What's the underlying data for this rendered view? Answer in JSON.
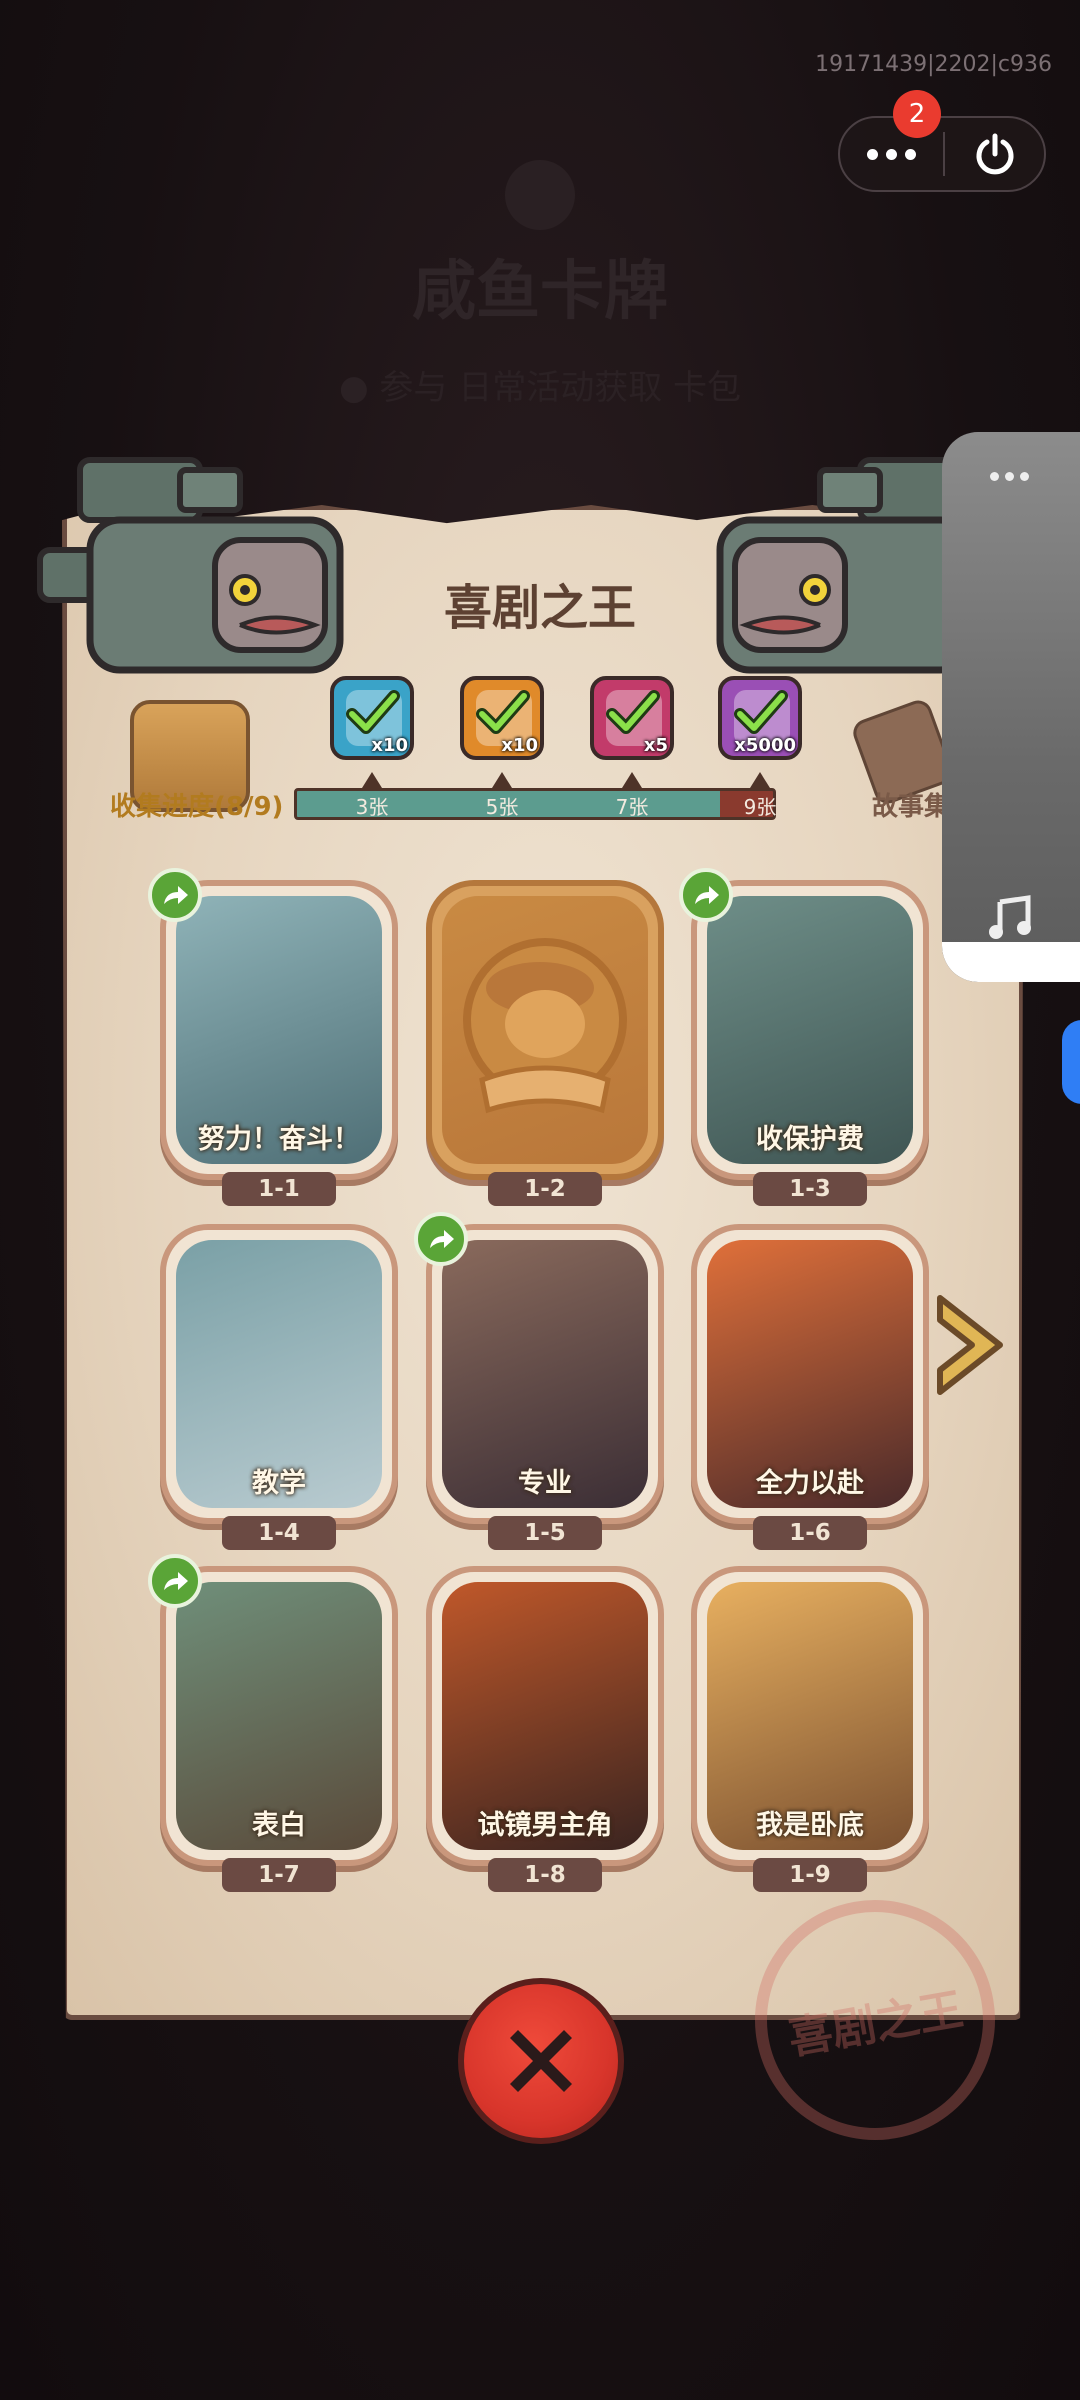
{
  "status": {
    "user_id": "19171439|2202|c936",
    "badge_count": "2"
  },
  "background": {
    "title": "咸鱼卡牌",
    "subtitle": "● 参与 日常活动获取 卡包"
  },
  "panel": {
    "title": "喜剧之王",
    "collection_label": "收集进度(8/9)",
    "story_label": "故事集",
    "stamp_text": "喜剧之王",
    "progress": {
      "collected": 8,
      "total": 9
    },
    "milestones": [
      {
        "label": "3张",
        "qty": "x10",
        "color": "#3aa3c8"
      },
      {
        "label": "5张",
        "qty": "x10",
        "color": "#e08a2a"
      },
      {
        "label": "7张",
        "qty": "x5",
        "color": "#c23b6a"
      },
      {
        "label": "9张",
        "qty": "x5000",
        "color": "#9a4fb5"
      }
    ]
  },
  "cards": [
    {
      "code": "1-1",
      "name": "努力！奋斗！",
      "shared": true,
      "locked": false,
      "art": [
        "#8fb3b8",
        "#4f6f76"
      ]
    },
    {
      "code": "1-2",
      "name": "",
      "shared": false,
      "locked": true,
      "art": [
        "#c98a43",
        "#b9773a"
      ]
    },
    {
      "code": "1-3",
      "name": "收保护费",
      "shared": true,
      "locked": false,
      "art": [
        "#6e8e88",
        "#3f5553"
      ]
    },
    {
      "code": "1-4",
      "name": "教学",
      "shared": false,
      "locked": false,
      "art": [
        "#7aa0a6",
        "#b9cbd0"
      ]
    },
    {
      "code": "1-5",
      "name": "专业",
      "shared": true,
      "locked": false,
      "art": [
        "#8a6a5c",
        "#3b2e35"
      ]
    },
    {
      "code": "1-6",
      "name": "全力以赴",
      "shared": false,
      "locked": false,
      "art": [
        "#e0703a",
        "#4a2a2a"
      ]
    },
    {
      "code": "1-7",
      "name": "表白",
      "shared": true,
      "locked": false,
      "art": [
        "#6f8f7a",
        "#5a4a3a"
      ]
    },
    {
      "code": "1-8",
      "name": "试镜男主角",
      "shared": false,
      "locked": false,
      "art": [
        "#c0582a",
        "#3a2420"
      ]
    },
    {
      "code": "1-9",
      "name": "我是卧底",
      "shared": false,
      "locked": false,
      "art": [
        "#e8b060",
        "#7a5030"
      ]
    }
  ]
}
